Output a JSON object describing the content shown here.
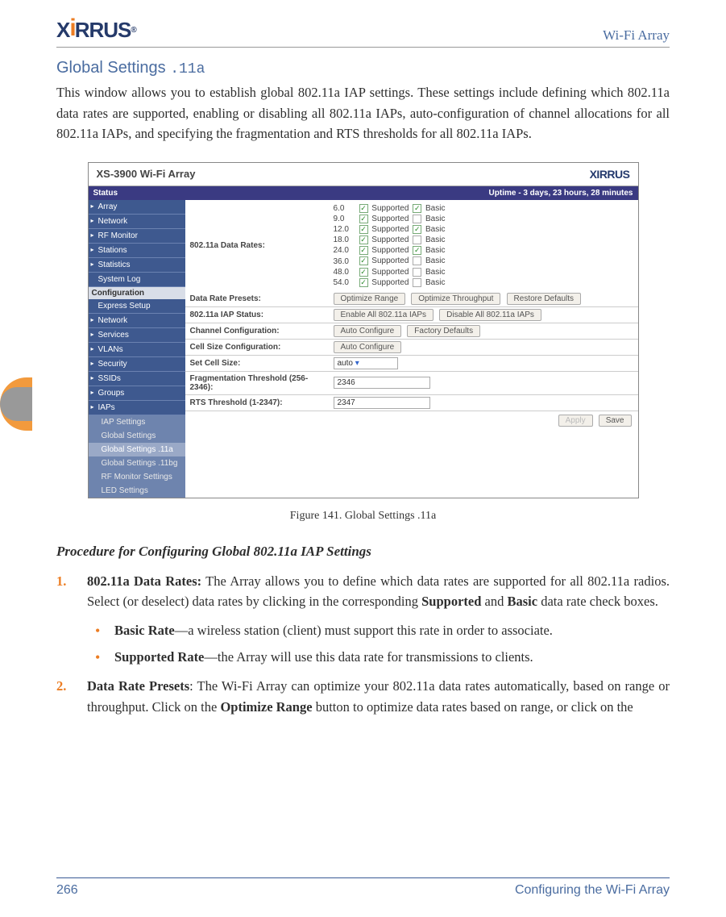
{
  "header": {
    "logo_text": "X",
    "logo_text2": "RRUS",
    "right": "Wi-Fi Array"
  },
  "section": {
    "title_main": "Global Settings ",
    "title_suffix": ".11a"
  },
  "intro": "This window allows you to establish global 802.11a IAP settings. These settings include defining which 802.11a data rates are supported, enabling or disabling all 802.11a IAPs, auto-configuration of channel allocations for all 802.11a IAPs, and specifying the fragmentation and RTS thresholds for all 802.11a IAPs.",
  "screenshot": {
    "title": "XS-3900 Wi-Fi Array",
    "brand": "XIRRUS",
    "status_left": "Status",
    "status_right": "Uptime - 3 days, 23 hours, 28 minutes",
    "side_status": [
      "Array",
      "Network",
      "RF Monitor",
      "Stations",
      "Statistics",
      "System Log"
    ],
    "side_config_hdr": "Configuration",
    "side_config": [
      "Express Setup",
      "Network",
      "Services",
      "VLANs",
      "Security",
      "SSIDs",
      "Groups",
      "IAPs"
    ],
    "side_iaps": [
      "IAP Settings",
      "Global Settings",
      "Global Settings .11a",
      "Global Settings .11bg",
      "RF Monitor Settings",
      "LED Settings"
    ],
    "rates_label": "802.11a Data Rates:",
    "rates": [
      {
        "r": "6.0",
        "s": true,
        "b": true
      },
      {
        "r": "9.0",
        "s": true,
        "b": false
      },
      {
        "r": "12.0",
        "s": true,
        "b": true
      },
      {
        "r": "18.0",
        "s": true,
        "b": false
      },
      {
        "r": "24.0",
        "s": true,
        "b": true
      },
      {
        "r": "36.0",
        "s": true,
        "b": false
      },
      {
        "r": "48.0",
        "s": true,
        "b": false
      },
      {
        "r": "54.0",
        "s": true,
        "b": false
      }
    ],
    "rows": {
      "presets": {
        "label": "Data Rate Presets:",
        "b1": "Optimize Range",
        "b2": "Optimize Throughput",
        "b3": "Restore Defaults"
      },
      "iapstatus": {
        "label": "802.11a IAP Status:",
        "b1": "Enable All 802.11a IAPs",
        "b2": "Disable All 802.11a IAPs"
      },
      "chan": {
        "label": "Channel Configuration:",
        "b1": "Auto Configure",
        "b2": "Factory Defaults"
      },
      "cellcfg": {
        "label": "Cell Size Configuration:",
        "b1": "Auto Configure"
      },
      "cellsize": {
        "label": "Set Cell Size:",
        "val": "auto"
      },
      "frag": {
        "label": "Fragmentation Threshold (256-2346):",
        "val": "2346"
      },
      "rts": {
        "label": "RTS Threshold (1-2347):",
        "val": "2347"
      }
    },
    "actions": {
      "apply": "Apply",
      "save": "Save"
    }
  },
  "figure_caption": "Figure 141. Global Settings .11a",
  "procedure_heading": "Procedure for Configuring Global 802.11a IAP Settings",
  "step1": {
    "num": "1.",
    "lead": "802.11a Data Rates:",
    "body1": " The Array allows you to define which data rates are supported for all 802.11a radios. Select (or deselect) data rates by clicking in the corresponding ",
    "b1": "Supported",
    "mid": " and ",
    "b2": "Basic",
    "body2": " data rate check boxes.",
    "bullet1_lead": "Basic Rate",
    "bullet1_body": "—a wireless station (client) must support this rate in order to associate.",
    "bullet2_lead": "Supported Rate",
    "bullet2_body": "—the Array will use this data rate for transmissions to clients."
  },
  "step2": {
    "num": "2.",
    "lead": "Data Rate Presets",
    "body1": ": The Wi-Fi Array can optimize your 802.11a data rates automatically, based on range or throughput. Click on the ",
    "b1": "Optimize Range",
    "body2": " button to optimize data rates based on range, or click on the"
  },
  "footer": {
    "page": "266",
    "right": "Configuring the Wi-Fi Array"
  },
  "labels": {
    "supported": "Supported",
    "basic": "Basic"
  }
}
